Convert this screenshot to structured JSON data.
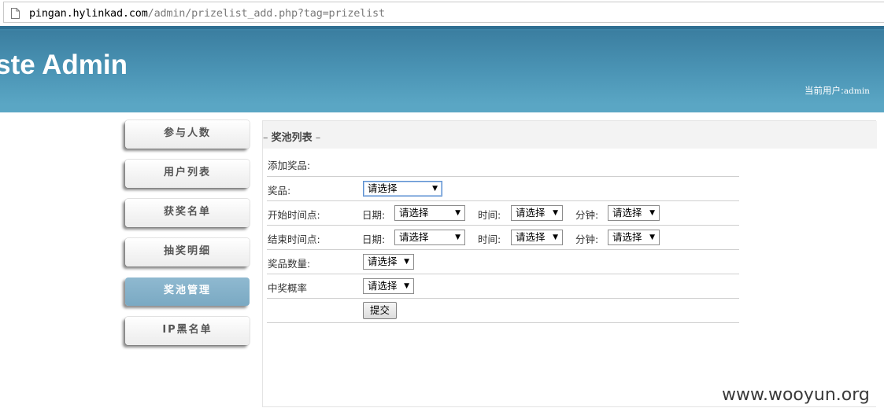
{
  "browser": {
    "url_host": "pingan.hylinkad.com",
    "url_path": "/admin/prizelist_add.php?tag=prizelist"
  },
  "header": {
    "site_title": "ste Admin",
    "current_user_label": "当前用户:",
    "current_user_name": "admin"
  },
  "sidebar": {
    "items": [
      {
        "label": "参与人数",
        "active": false
      },
      {
        "label": "用户列表",
        "active": false
      },
      {
        "label": "获奖名单",
        "active": false
      },
      {
        "label": "抽奖明细",
        "active": false
      },
      {
        "label": "奖池管理",
        "active": true
      },
      {
        "label": "IP黑名单",
        "active": false
      }
    ]
  },
  "panel": {
    "title_dash_left": "– ",
    "title": "奖池列表",
    "title_dash_right": " –"
  },
  "form": {
    "heading": "添加奖品:",
    "prize_label": "奖品:",
    "prize_value": "请选择",
    "start_label": "开始时间点:",
    "end_label": "结束时间点:",
    "date_label": "日期:",
    "time_label": "时间:",
    "minute_label": "分钟:",
    "start_date_value": "请选择",
    "start_time_value": "请选择",
    "start_minute_value": "请选择",
    "end_date_value": "请选择",
    "end_time_value": "请选择",
    "end_minute_value": "请选择",
    "quantity_label": "奖品数量:",
    "quantity_value": "请选择",
    "probability_label": "中奖概率",
    "probability_value": "请选择",
    "submit_label": "提交"
  },
  "watermark": "www.wooyun.org",
  "icons": {
    "page": "page-icon",
    "dropdown": "dropdown-arrow-icon"
  },
  "colors": {
    "header_blue": "#4a93b4",
    "active_nav": "#7aa9c3"
  }
}
